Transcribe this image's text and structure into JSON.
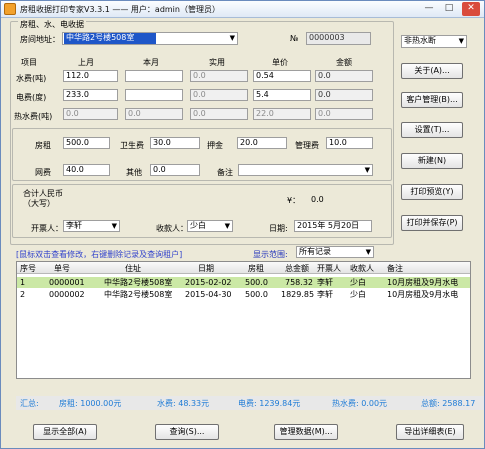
{
  "window": {
    "title": "房租收据打印专家V3.3.1 —— 用户：admin（管理员）",
    "minimize": "—",
    "maximize": "□",
    "close": "✕"
  },
  "form": {
    "group_title": "房租、水、电收据",
    "address_label": "房间地址：",
    "address_value": "中华路2号楼508室",
    "no_label": "№",
    "no_value": "0000003",
    "columns": {
      "item": "项目",
      "last_month": "上月",
      "this_month": "本月",
      "used": "实用",
      "unit_price": "单价",
      "amount": "金额"
    },
    "rows": [
      {
        "label": "水费(吨)",
        "last": "112.0",
        "this": "",
        "used": "0.0",
        "price": "0.54",
        "amount": "0.0"
      },
      {
        "label": "电费(度)",
        "last": "233.0",
        "this": "",
        "used": "0.0",
        "price": "5.4",
        "amount": "0.0"
      },
      {
        "label": "热水费(吨)",
        "last": "0.0",
        "this": "0.0",
        "used": "0.0",
        "price": "22.0",
        "amount": "0.0"
      }
    ],
    "fees": {
      "rent_label": "房租",
      "rent": "500.0",
      "sanitation_label": "卫生费",
      "sanitation": "30.0",
      "deposit_label": "押金",
      "deposit": "20.0",
      "management_label": "管理费",
      "management": "10.0",
      "internet_label": "网费",
      "internet": "40.0",
      "other_label": "其他",
      "other": "0.0",
      "remark_label": "备注",
      "remark": ""
    },
    "total": {
      "label": "合计人民币",
      "sub_label": "（大写）",
      "yuan_label": "¥：",
      "yuan_value": "0.0"
    },
    "issuer_label": "开票人：",
    "issuer": "李轩",
    "payee_label": "收款人：",
    "payee": "少白",
    "date_label": "日期:",
    "date": "2015年 5月20日"
  },
  "side_buttons": {
    "water_type": "非热水断",
    "about": "关于(A)...",
    "customer": "客户管理(B)...",
    "settings": "设置(T)...",
    "new": "新建(N)",
    "print_preview": "打印预览(Y)",
    "print_save": "打印并保存(P)"
  },
  "list": {
    "hint": "[鼠标双击查看修改，右键删除记录及查询租户]",
    "range_label": "显示范围:",
    "range_value": "所有记录",
    "headers": [
      "序号",
      "单号",
      "住址",
      "日期",
      "房租",
      "总金额",
      "开票人",
      "收款人",
      "备注"
    ],
    "rows": [
      [
        "1",
        "0000001",
        "中华路2号楼508室",
        "2015-02-02",
        "500.0",
        "758.32",
        "李轩",
        "少白",
        "10月房租及9月水电"
      ],
      [
        "2",
        "0000002",
        "中华路2号楼508室",
        "2015-04-30",
        "500.0",
        "1829.85",
        "李轩",
        "少白",
        "10月房租及9月水电"
      ]
    ]
  },
  "summary": {
    "total_label": "汇总:",
    "rent": "房租: 1000.00元",
    "water": "水费: 48.33元",
    "electric": "电费: 1239.84元",
    "hotwater": "热水费: 0.00元",
    "total": "总额: 2588.17"
  },
  "bottom_buttons": {
    "show_all": "显示全部(A)",
    "query": "查询(S)...",
    "manage": "管理数据(M)...",
    "export": "导出详细表(E)"
  }
}
